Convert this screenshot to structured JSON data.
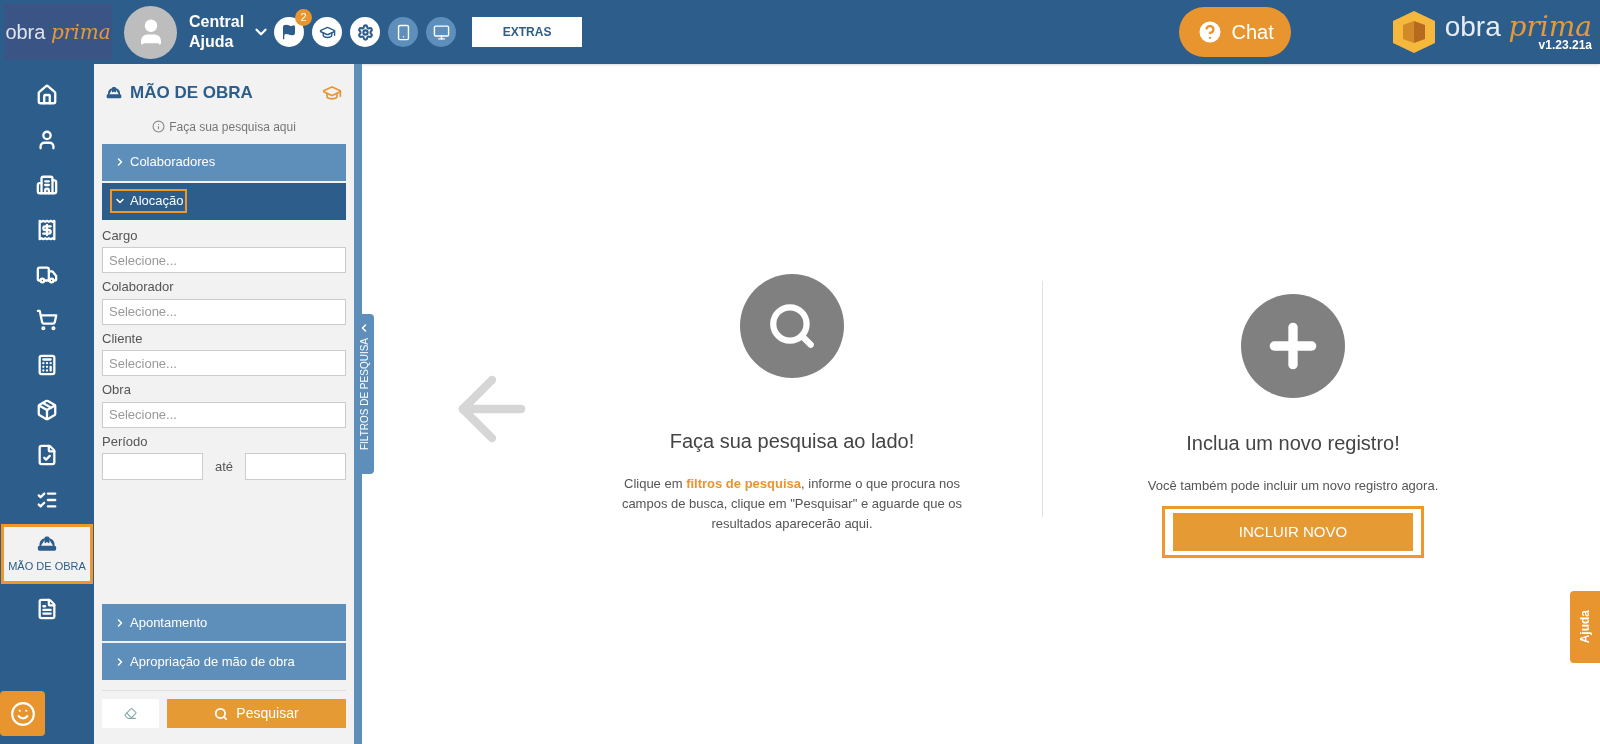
{
  "topbar": {
    "logo_left": {
      "word1": "obra",
      "word2": "prima"
    },
    "user": {
      "line1": "Central",
      "line2": "Ajuda"
    },
    "notifications_badge": "2",
    "extras_button": "EXTRAS",
    "chat_button": "Chat",
    "logo_right": {
      "word1": "obra",
      "word2": "prima"
    },
    "version": "v1.23.21a"
  },
  "nav": [
    {
      "selected": false
    },
    {
      "selected": false
    },
    {
      "selected": false
    },
    {
      "selected": false
    },
    {
      "selected": false
    },
    {
      "selected": false
    },
    {
      "selected": false
    },
    {
      "selected": false
    },
    {
      "selected": false
    },
    {
      "selected": false
    },
    {
      "selected": true,
      "label": "MÃO DE OBRA",
      "highlighted": true
    },
    {
      "selected": false
    }
  ],
  "filter_panel": {
    "title": "MÃO DE OBRA",
    "hint": "Faça sua pesquisa aqui",
    "tab_label": "FILTROS DE PESQUISA",
    "sections": [
      {
        "label": "Colaboradores",
        "expanded": false,
        "highlighted": false
      },
      {
        "label": "Alocação",
        "expanded": true,
        "highlighted": true,
        "fields": [
          {
            "kind": "select",
            "label": "Cargo",
            "placeholder": "Selecione..."
          },
          {
            "kind": "select",
            "label": "Colaborador",
            "placeholder": "Selecione..."
          },
          {
            "kind": "select",
            "label": "Cliente",
            "placeholder": "Selecione..."
          },
          {
            "kind": "select",
            "label": "Obra",
            "placeholder": "Selecione..."
          },
          {
            "kind": "range",
            "label": "Período",
            "separator": "até"
          }
        ]
      },
      {
        "label": "Apontamento",
        "expanded": false,
        "highlighted": false
      },
      {
        "label": "Apropriação de mão de obra",
        "expanded": false,
        "highlighted": false
      }
    ],
    "search_button": "Pesquisar"
  },
  "main": {
    "search_card": {
      "title": "Faça sua pesquisa ao lado!",
      "text": "Clique em **filtros de pesquisa**, informe o que procura nos campos de busca, clique em \"Pesquisar\" e aguarde que os resultados aparecerão aqui."
    },
    "new_card": {
      "title": "Inclua um novo registro!",
      "text": "Você também pode incluir um novo registro agora.",
      "button": "INCLUIR NOVO",
      "highlighted": true
    },
    "help_tab": "Ajuda"
  }
}
